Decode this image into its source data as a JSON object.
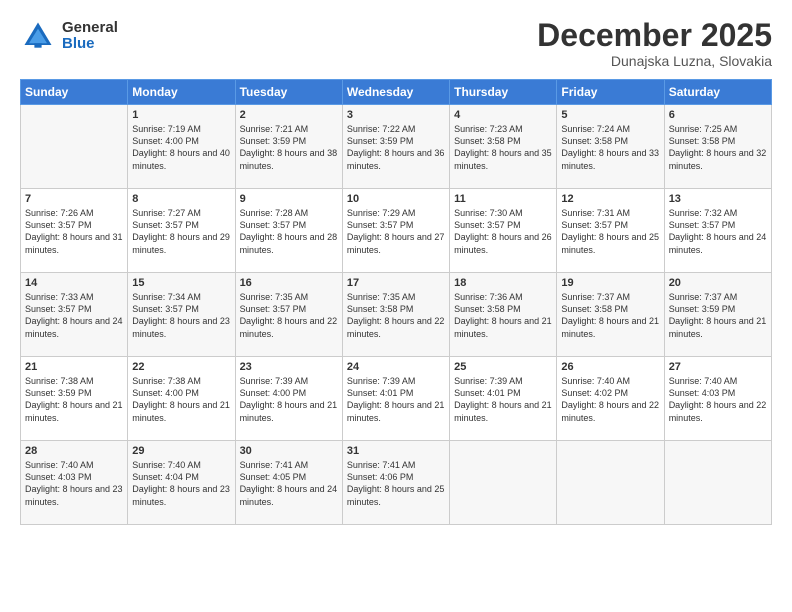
{
  "logo": {
    "general": "General",
    "blue": "Blue"
  },
  "title": "December 2025",
  "location": "Dunajska Luzna, Slovakia",
  "days_header": [
    "Sunday",
    "Monday",
    "Tuesday",
    "Wednesday",
    "Thursday",
    "Friday",
    "Saturday"
  ],
  "weeks": [
    [
      {
        "day": "",
        "sunrise": "",
        "sunset": "",
        "daylight": ""
      },
      {
        "day": "1",
        "sunrise": "Sunrise: 7:19 AM",
        "sunset": "Sunset: 4:00 PM",
        "daylight": "Daylight: 8 hours and 40 minutes."
      },
      {
        "day": "2",
        "sunrise": "Sunrise: 7:21 AM",
        "sunset": "Sunset: 3:59 PM",
        "daylight": "Daylight: 8 hours and 38 minutes."
      },
      {
        "day": "3",
        "sunrise": "Sunrise: 7:22 AM",
        "sunset": "Sunset: 3:59 PM",
        "daylight": "Daylight: 8 hours and 36 minutes."
      },
      {
        "day": "4",
        "sunrise": "Sunrise: 7:23 AM",
        "sunset": "Sunset: 3:58 PM",
        "daylight": "Daylight: 8 hours and 35 minutes."
      },
      {
        "day": "5",
        "sunrise": "Sunrise: 7:24 AM",
        "sunset": "Sunset: 3:58 PM",
        "daylight": "Daylight: 8 hours and 33 minutes."
      },
      {
        "day": "6",
        "sunrise": "Sunrise: 7:25 AM",
        "sunset": "Sunset: 3:58 PM",
        "daylight": "Daylight: 8 hours and 32 minutes."
      }
    ],
    [
      {
        "day": "7",
        "sunrise": "Sunrise: 7:26 AM",
        "sunset": "Sunset: 3:57 PM",
        "daylight": "Daylight: 8 hours and 31 minutes."
      },
      {
        "day": "8",
        "sunrise": "Sunrise: 7:27 AM",
        "sunset": "Sunset: 3:57 PM",
        "daylight": "Daylight: 8 hours and 29 minutes."
      },
      {
        "day": "9",
        "sunrise": "Sunrise: 7:28 AM",
        "sunset": "Sunset: 3:57 PM",
        "daylight": "Daylight: 8 hours and 28 minutes."
      },
      {
        "day": "10",
        "sunrise": "Sunrise: 7:29 AM",
        "sunset": "Sunset: 3:57 PM",
        "daylight": "Daylight: 8 hours and 27 minutes."
      },
      {
        "day": "11",
        "sunrise": "Sunrise: 7:30 AM",
        "sunset": "Sunset: 3:57 PM",
        "daylight": "Daylight: 8 hours and 26 minutes."
      },
      {
        "day": "12",
        "sunrise": "Sunrise: 7:31 AM",
        "sunset": "Sunset: 3:57 PM",
        "daylight": "Daylight: 8 hours and 25 minutes."
      },
      {
        "day": "13",
        "sunrise": "Sunrise: 7:32 AM",
        "sunset": "Sunset: 3:57 PM",
        "daylight": "Daylight: 8 hours and 24 minutes."
      }
    ],
    [
      {
        "day": "14",
        "sunrise": "Sunrise: 7:33 AM",
        "sunset": "Sunset: 3:57 PM",
        "daylight": "Daylight: 8 hours and 24 minutes."
      },
      {
        "day": "15",
        "sunrise": "Sunrise: 7:34 AM",
        "sunset": "Sunset: 3:57 PM",
        "daylight": "Daylight: 8 hours and 23 minutes."
      },
      {
        "day": "16",
        "sunrise": "Sunrise: 7:35 AM",
        "sunset": "Sunset: 3:57 PM",
        "daylight": "Daylight: 8 hours and 22 minutes."
      },
      {
        "day": "17",
        "sunrise": "Sunrise: 7:35 AM",
        "sunset": "Sunset: 3:58 PM",
        "daylight": "Daylight: 8 hours and 22 minutes."
      },
      {
        "day": "18",
        "sunrise": "Sunrise: 7:36 AM",
        "sunset": "Sunset: 3:58 PM",
        "daylight": "Daylight: 8 hours and 21 minutes."
      },
      {
        "day": "19",
        "sunrise": "Sunrise: 7:37 AM",
        "sunset": "Sunset: 3:58 PM",
        "daylight": "Daylight: 8 hours and 21 minutes."
      },
      {
        "day": "20",
        "sunrise": "Sunrise: 7:37 AM",
        "sunset": "Sunset: 3:59 PM",
        "daylight": "Daylight: 8 hours and 21 minutes."
      }
    ],
    [
      {
        "day": "21",
        "sunrise": "Sunrise: 7:38 AM",
        "sunset": "Sunset: 3:59 PM",
        "daylight": "Daylight: 8 hours and 21 minutes."
      },
      {
        "day": "22",
        "sunrise": "Sunrise: 7:38 AM",
        "sunset": "Sunset: 4:00 PM",
        "daylight": "Daylight: 8 hours and 21 minutes."
      },
      {
        "day": "23",
        "sunrise": "Sunrise: 7:39 AM",
        "sunset": "Sunset: 4:00 PM",
        "daylight": "Daylight: 8 hours and 21 minutes."
      },
      {
        "day": "24",
        "sunrise": "Sunrise: 7:39 AM",
        "sunset": "Sunset: 4:01 PM",
        "daylight": "Daylight: 8 hours and 21 minutes."
      },
      {
        "day": "25",
        "sunrise": "Sunrise: 7:39 AM",
        "sunset": "Sunset: 4:01 PM",
        "daylight": "Daylight: 8 hours and 21 minutes."
      },
      {
        "day": "26",
        "sunrise": "Sunrise: 7:40 AM",
        "sunset": "Sunset: 4:02 PM",
        "daylight": "Daylight: 8 hours and 22 minutes."
      },
      {
        "day": "27",
        "sunrise": "Sunrise: 7:40 AM",
        "sunset": "Sunset: 4:03 PM",
        "daylight": "Daylight: 8 hours and 22 minutes."
      }
    ],
    [
      {
        "day": "28",
        "sunrise": "Sunrise: 7:40 AM",
        "sunset": "Sunset: 4:03 PM",
        "daylight": "Daylight: 8 hours and 23 minutes."
      },
      {
        "day": "29",
        "sunrise": "Sunrise: 7:40 AM",
        "sunset": "Sunset: 4:04 PM",
        "daylight": "Daylight: 8 hours and 23 minutes."
      },
      {
        "day": "30",
        "sunrise": "Sunrise: 7:41 AM",
        "sunset": "Sunset: 4:05 PM",
        "daylight": "Daylight: 8 hours and 24 minutes."
      },
      {
        "day": "31",
        "sunrise": "Sunrise: 7:41 AM",
        "sunset": "Sunset: 4:06 PM",
        "daylight": "Daylight: 8 hours and 25 minutes."
      },
      {
        "day": "",
        "sunrise": "",
        "sunset": "",
        "daylight": ""
      },
      {
        "day": "",
        "sunrise": "",
        "sunset": "",
        "daylight": ""
      },
      {
        "day": "",
        "sunrise": "",
        "sunset": "",
        "daylight": ""
      }
    ]
  ]
}
